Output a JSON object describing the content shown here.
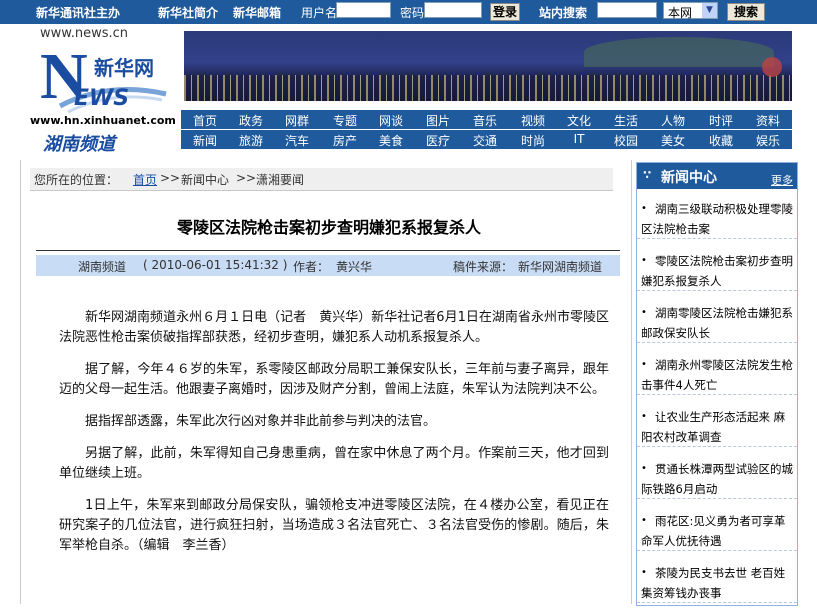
{
  "topbar": {
    "sponsor": "新华通讯社主办",
    "about": "新华社简介",
    "mail": "新华邮箱",
    "username_label": "用户名",
    "password_label": "密码",
    "login_button": "登录",
    "site_search_label": "站内搜索",
    "scope_selected": "本网",
    "search_button": "搜索"
  },
  "logo": {
    "url_text": "www.news.cn",
    "brand": "新华网",
    "news_text": "EWS",
    "site_url": "www.hn.xinhuanet.com",
    "channel": "湖南频道"
  },
  "nav": {
    "row1": [
      "首页",
      "政务",
      "网群",
      "专题",
      "网谈",
      "图片",
      "音乐",
      "视频",
      "文化",
      "生活",
      "人物",
      "时评",
      "资料"
    ],
    "row2": [
      "新闻",
      "旅游",
      "汽车",
      "房产",
      "美食",
      "医疗",
      "交通",
      "时尚",
      "IT",
      "校园",
      "美女",
      "收藏",
      "娱乐"
    ]
  },
  "breadcrumb": {
    "label": "您所在的位置：",
    "items": [
      "首页",
      "新闻中心",
      "潇湘要闻"
    ],
    "separator": ">>"
  },
  "article": {
    "title": "零陵区法院枪击案初步查明嫌犯系报复杀人",
    "source_channel": "湖南频道",
    "datetime": "( 2010-06-01 15:41:32 )",
    "author_label": "作者：",
    "author": "黄兴华",
    "origin_label": "稿件来源：",
    "origin": "新华网湖南频道",
    "paragraphs": [
      "新华网湖南频道永州６月１日电（记者　黄兴华）新华社记者6月1日在湖南省永州市零陵区法院恶性枪击案侦破指挥部获悉，经初步查明，嫌犯系人动机系报复杀人。",
      "据了解，今年４６岁的朱军，系零陵区邮政分局职工兼保安队长，三年前与妻子离异，跟年迈的父母一起生活。他跟妻子离婚时，因涉及财产分割，曾闹上法庭，朱军认为法院判决不公。",
      "据指挥部透露，朱军此次行凶对象并非此前参与判决的法官。",
      "另据了解，此前，朱军得知自己身患重病，曾在家中休息了两个月。作案前三天，他才回到单位继续上班。",
      "1日上午，朱军来到邮政分局保安队，骗领枪支冲进零陵区法院，在４楼办公室，看见正在研究案子的几位法官，进行疯狂扫射，当场造成３名法官死亡、３名法官受伤的惨剧。随后，朱军举枪自杀。（编辑　李兰香）"
    ]
  },
  "sidebar": {
    "title": "新闻中心",
    "more": "更多",
    "items": [
      "湖南三级联动积极处理零陵区法院枪击案",
      "零陵区法院枪击案初步查明嫌犯系报复杀人",
      "湖南零陵区法院枪击嫌犯系邮政保安队长",
      "湖南永州零陵区法院发生枪击事件4人死亡",
      "让农业生产形态活起来 麻阳农村改革调查",
      "贯通长株潭两型试验区的城际铁路6月启动",
      "雨花区:见义勇为者可享革命军人优抚待遇",
      "茶陵为民支书去世 老百姓集资筹钱办丧事"
    ]
  },
  "colors": {
    "brand_blue": "#1f5a9c",
    "meta_bar": "#c8dcf5",
    "breadcrumb_bg": "#efefef"
  }
}
